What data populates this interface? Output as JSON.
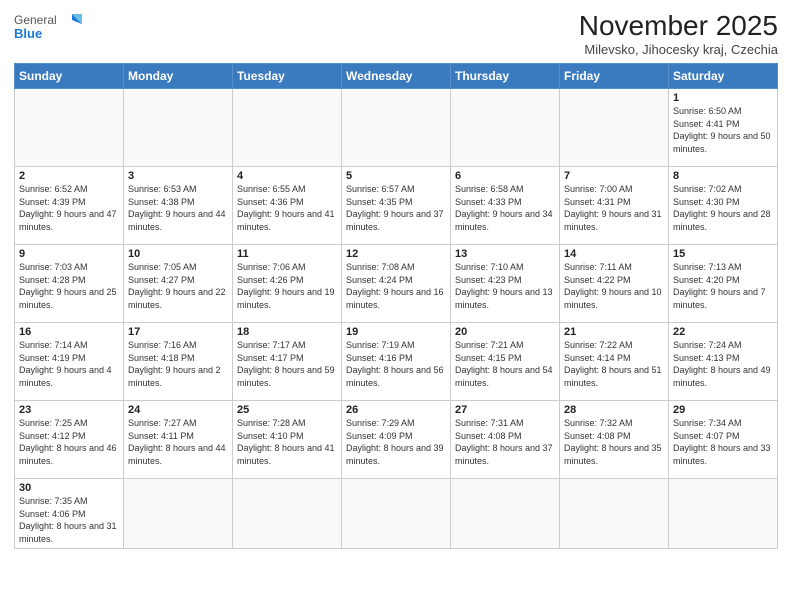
{
  "header": {
    "logo_general": "General",
    "logo_blue": "Blue",
    "title": "November 2025",
    "location": "Milevsko, Jihocesky kraj, Czechia"
  },
  "days_of_week": [
    "Sunday",
    "Monday",
    "Tuesday",
    "Wednesday",
    "Thursday",
    "Friday",
    "Saturday"
  ],
  "weeks": [
    [
      {
        "num": "",
        "info": ""
      },
      {
        "num": "",
        "info": ""
      },
      {
        "num": "",
        "info": ""
      },
      {
        "num": "",
        "info": ""
      },
      {
        "num": "",
        "info": ""
      },
      {
        "num": "",
        "info": ""
      },
      {
        "num": "1",
        "info": "Sunrise: 6:50 AM\nSunset: 4:41 PM\nDaylight: 9 hours and 50 minutes."
      }
    ],
    [
      {
        "num": "2",
        "info": "Sunrise: 6:52 AM\nSunset: 4:39 PM\nDaylight: 9 hours and 47 minutes."
      },
      {
        "num": "3",
        "info": "Sunrise: 6:53 AM\nSunset: 4:38 PM\nDaylight: 9 hours and 44 minutes."
      },
      {
        "num": "4",
        "info": "Sunrise: 6:55 AM\nSunset: 4:36 PM\nDaylight: 9 hours and 41 minutes."
      },
      {
        "num": "5",
        "info": "Sunrise: 6:57 AM\nSunset: 4:35 PM\nDaylight: 9 hours and 37 minutes."
      },
      {
        "num": "6",
        "info": "Sunrise: 6:58 AM\nSunset: 4:33 PM\nDaylight: 9 hours and 34 minutes."
      },
      {
        "num": "7",
        "info": "Sunrise: 7:00 AM\nSunset: 4:31 PM\nDaylight: 9 hours and 31 minutes."
      },
      {
        "num": "8",
        "info": "Sunrise: 7:02 AM\nSunset: 4:30 PM\nDaylight: 9 hours and 28 minutes."
      }
    ],
    [
      {
        "num": "9",
        "info": "Sunrise: 7:03 AM\nSunset: 4:28 PM\nDaylight: 9 hours and 25 minutes."
      },
      {
        "num": "10",
        "info": "Sunrise: 7:05 AM\nSunset: 4:27 PM\nDaylight: 9 hours and 22 minutes."
      },
      {
        "num": "11",
        "info": "Sunrise: 7:06 AM\nSunset: 4:26 PM\nDaylight: 9 hours and 19 minutes."
      },
      {
        "num": "12",
        "info": "Sunrise: 7:08 AM\nSunset: 4:24 PM\nDaylight: 9 hours and 16 minutes."
      },
      {
        "num": "13",
        "info": "Sunrise: 7:10 AM\nSunset: 4:23 PM\nDaylight: 9 hours and 13 minutes."
      },
      {
        "num": "14",
        "info": "Sunrise: 7:11 AM\nSunset: 4:22 PM\nDaylight: 9 hours and 10 minutes."
      },
      {
        "num": "15",
        "info": "Sunrise: 7:13 AM\nSunset: 4:20 PM\nDaylight: 9 hours and 7 minutes."
      }
    ],
    [
      {
        "num": "16",
        "info": "Sunrise: 7:14 AM\nSunset: 4:19 PM\nDaylight: 9 hours and 4 minutes."
      },
      {
        "num": "17",
        "info": "Sunrise: 7:16 AM\nSunset: 4:18 PM\nDaylight: 9 hours and 2 minutes."
      },
      {
        "num": "18",
        "info": "Sunrise: 7:17 AM\nSunset: 4:17 PM\nDaylight: 8 hours and 59 minutes."
      },
      {
        "num": "19",
        "info": "Sunrise: 7:19 AM\nSunset: 4:16 PM\nDaylight: 8 hours and 56 minutes."
      },
      {
        "num": "20",
        "info": "Sunrise: 7:21 AM\nSunset: 4:15 PM\nDaylight: 8 hours and 54 minutes."
      },
      {
        "num": "21",
        "info": "Sunrise: 7:22 AM\nSunset: 4:14 PM\nDaylight: 8 hours and 51 minutes."
      },
      {
        "num": "22",
        "info": "Sunrise: 7:24 AM\nSunset: 4:13 PM\nDaylight: 8 hours and 49 minutes."
      }
    ],
    [
      {
        "num": "23",
        "info": "Sunrise: 7:25 AM\nSunset: 4:12 PM\nDaylight: 8 hours and 46 minutes."
      },
      {
        "num": "24",
        "info": "Sunrise: 7:27 AM\nSunset: 4:11 PM\nDaylight: 8 hours and 44 minutes."
      },
      {
        "num": "25",
        "info": "Sunrise: 7:28 AM\nSunset: 4:10 PM\nDaylight: 8 hours and 41 minutes."
      },
      {
        "num": "26",
        "info": "Sunrise: 7:29 AM\nSunset: 4:09 PM\nDaylight: 8 hours and 39 minutes."
      },
      {
        "num": "27",
        "info": "Sunrise: 7:31 AM\nSunset: 4:08 PM\nDaylight: 8 hours and 37 minutes."
      },
      {
        "num": "28",
        "info": "Sunrise: 7:32 AM\nSunset: 4:08 PM\nDaylight: 8 hours and 35 minutes."
      },
      {
        "num": "29",
        "info": "Sunrise: 7:34 AM\nSunset: 4:07 PM\nDaylight: 8 hours and 33 minutes."
      }
    ],
    [
      {
        "num": "30",
        "info": "Sunrise: 7:35 AM\nSunset: 4:06 PM\nDaylight: 8 hours and 31 minutes."
      },
      {
        "num": "",
        "info": ""
      },
      {
        "num": "",
        "info": ""
      },
      {
        "num": "",
        "info": ""
      },
      {
        "num": "",
        "info": ""
      },
      {
        "num": "",
        "info": ""
      },
      {
        "num": "",
        "info": ""
      }
    ]
  ]
}
